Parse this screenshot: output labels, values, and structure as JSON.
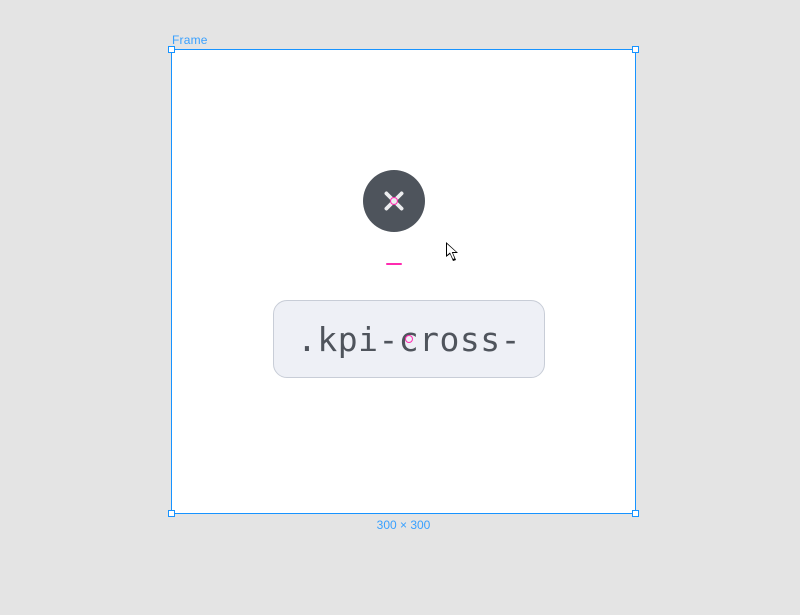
{
  "colors": {
    "selection": "#1793ff",
    "accent_pink": "#ff2bb0",
    "badge_fill": "#4e545c",
    "label_bg": "#eef0f6",
    "label_border": "#c8cdd7"
  },
  "frame": {
    "name": "Frame",
    "dimensions_label": "300 × 300"
  },
  "nodes": {
    "class_label_text": ".kpi-cross-"
  }
}
